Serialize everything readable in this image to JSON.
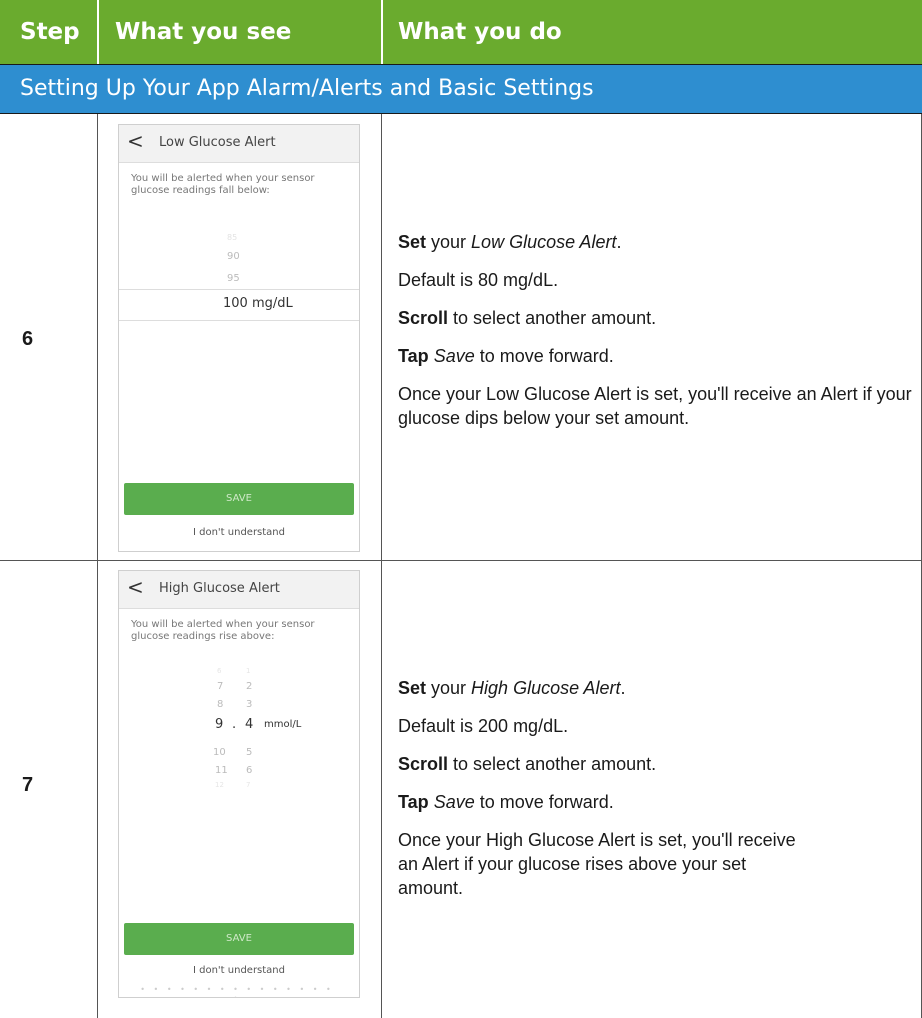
{
  "header": {
    "col_step": "Step",
    "col_see": "What you see",
    "col_do": "What you do"
  },
  "section_title": "Setting Up Your App Alarm/Alerts and Basic Settings",
  "rows": [
    {
      "step": "6",
      "screen": {
        "back_icon": "<",
        "title": "Low Glucose Alert",
        "description": "You will be alerted when your sensor glucose readings fall below:",
        "wheel_above": [
          "85",
          "90",
          "95"
        ],
        "selected": "100 mg/dL",
        "save": "SAVE",
        "help": "I don't understand"
      },
      "instructions": {
        "l1_bold": "Set",
        "l1_text": " your ",
        "l1_italic": "Low Glucose Alert",
        "l1_end": ".",
        "l2": "Default is 80 mg/dL.",
        "l3_bold": "Scroll",
        "l3_text": " to select another amount.",
        "l4_bold": "Tap",
        "l4_italic": "Save",
        "l4_text": " to move forward.",
        "l5": "Once your Low Glucose Alert is set, you'll receive an Alert if your glucose dips below your set amount."
      }
    },
    {
      "step": "7",
      "screen": {
        "back_icon": "<",
        "title": "High Glucose Alert",
        "description": "You will be alerted when your sensor glucose readings rise above:",
        "wheel_left_above": [
          "6",
          "7",
          "8"
        ],
        "wheel_right_above": [
          "1",
          "2",
          "3"
        ],
        "sel_left": "9",
        "sel_dot": ".",
        "sel_right": "4",
        "sel_unit": "mmol/L",
        "wheel_left_below": [
          "10",
          "11",
          "12"
        ],
        "wheel_right_below": [
          "5",
          "6",
          "7"
        ],
        "save": "SAVE",
        "help": "I don't understand",
        "dots": "• • • • • • • • • • • • • • • •"
      },
      "instructions": {
        "l1_bold": "Set",
        "l1_text": " your ",
        "l1_italic": "High Glucose Alert",
        "l1_end": ".",
        "l2": "Default is 200 mg/dL.",
        "l3_bold": "Scroll",
        "l3_text": " to select another amount.",
        "l4_bold": "Tap",
        "l4_italic": "Save",
        "l4_text": " to move forward.",
        "l5": "Once your High Glucose Alert is set, you'll receive an Alert if your glucose rises above your set amount."
      }
    }
  ],
  "colors": {
    "header_green": "#6aab2e",
    "section_blue": "#2e8ed0",
    "save_green": "#5aad4e"
  }
}
